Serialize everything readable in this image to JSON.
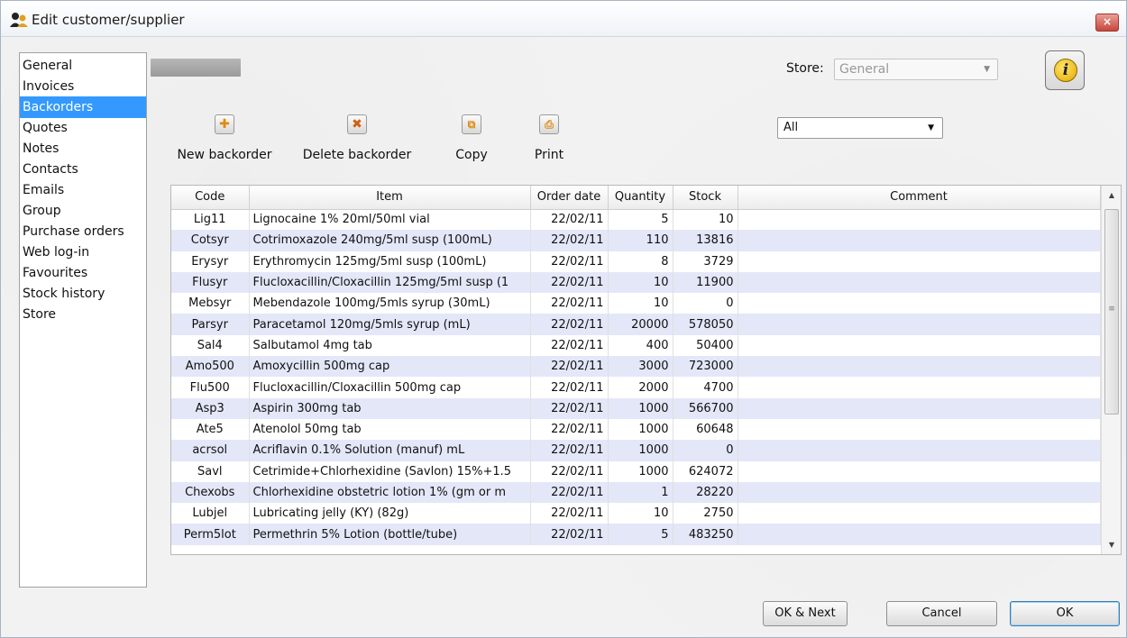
{
  "window": {
    "title": "Edit customer/supplier",
    "close_glyph": "×"
  },
  "sidebar": {
    "items": [
      {
        "label": "General"
      },
      {
        "label": "Invoices"
      },
      {
        "label": "Backorders",
        "selected": true
      },
      {
        "label": "Quotes"
      },
      {
        "label": "Notes"
      },
      {
        "label": "Contacts"
      },
      {
        "label": "Emails"
      },
      {
        "label": "Group"
      },
      {
        "label": "Purchase orders"
      },
      {
        "label": "Web log-in"
      },
      {
        "label": "Favourites"
      },
      {
        "label": "Stock history"
      },
      {
        "label": "Store"
      }
    ]
  },
  "header": {
    "store_label": "Store:",
    "store_value": "General",
    "info_glyph": "i"
  },
  "toolbar": {
    "new_label": "New backorder",
    "delete_label": "Delete backorder",
    "copy_label": "Copy",
    "print_label": "Print",
    "filter_value": "All"
  },
  "table": {
    "columns": [
      "Code",
      "Item",
      "Order date",
      "Quantity",
      "Stock",
      "Comment"
    ],
    "rows": [
      {
        "code": "Lig11",
        "item": "Lignocaine 1% 20ml/50ml vial",
        "date": "22/02/11",
        "qty": "5",
        "stock": "10",
        "comment": ""
      },
      {
        "code": "Cotsyr",
        "item": "Cotrimoxazole 240mg/5ml susp (100mL)",
        "date": "22/02/11",
        "qty": "110",
        "stock": "13816",
        "comment": ""
      },
      {
        "code": "Erysyr",
        "item": "Erythromycin 125mg/5ml susp (100mL)",
        "date": "22/02/11",
        "qty": "8",
        "stock": "3729",
        "comment": ""
      },
      {
        "code": "Flusyr",
        "item": "Flucloxacillin/Cloxacillin 125mg/5ml susp (1",
        "date": "22/02/11",
        "qty": "10",
        "stock": "11900",
        "comment": ""
      },
      {
        "code": "Mebsyr",
        "item": "Mebendazole 100mg/5mls syrup (30mL)",
        "date": "22/02/11",
        "qty": "10",
        "stock": "0",
        "comment": ""
      },
      {
        "code": "Parsyr",
        "item": "Paracetamol 120mg/5mls syrup (mL)",
        "date": "22/02/11",
        "qty": "20000",
        "stock": "578050",
        "comment": ""
      },
      {
        "code": "Sal4",
        "item": "Salbutamol 4mg tab",
        "date": "22/02/11",
        "qty": "400",
        "stock": "50400",
        "comment": ""
      },
      {
        "code": "Amo500",
        "item": "Amoxycillin 500mg cap",
        "date": "22/02/11",
        "qty": "3000",
        "stock": "723000",
        "comment": ""
      },
      {
        "code": "Flu500",
        "item": "Flucloxacillin/Cloxacillin 500mg cap",
        "date": "22/02/11",
        "qty": "2000",
        "stock": "4700",
        "comment": ""
      },
      {
        "code": "Asp3",
        "item": "Aspirin 300mg tab",
        "date": "22/02/11",
        "qty": "1000",
        "stock": "566700",
        "comment": ""
      },
      {
        "code": "Ate5",
        "item": "Atenolol 50mg tab",
        "date": "22/02/11",
        "qty": "1000",
        "stock": "60648",
        "comment": ""
      },
      {
        "code": "acrsol",
        "item": "Acriflavin 0.1% Solution (manuf) mL",
        "date": "22/02/11",
        "qty": "1000",
        "stock": "0",
        "comment": ""
      },
      {
        "code": "Savl",
        "item": "Cetrimide+Chlorhexidine (Savlon) 15%+1.5",
        "date": "22/02/11",
        "qty": "1000",
        "stock": "624072",
        "comment": ""
      },
      {
        "code": "Chexobs",
        "item": "Chlorhexidine obstetric lotion 1% (gm or m",
        "date": "22/02/11",
        "qty": "1",
        "stock": "28220",
        "comment": ""
      },
      {
        "code": "Lubjel",
        "item": "Lubricating jelly (KY) (82g)",
        "date": "22/02/11",
        "qty": "10",
        "stock": "2750",
        "comment": ""
      },
      {
        "code": "Perm5lot",
        "item": "Permethrin 5% Lotion (bottle/tube)",
        "date": "22/02/11",
        "qty": "5",
        "stock": "483250",
        "comment": ""
      }
    ]
  },
  "footer": {
    "ok_next_label": "OK & Next",
    "cancel_label": "Cancel",
    "ok_label": "OK"
  }
}
